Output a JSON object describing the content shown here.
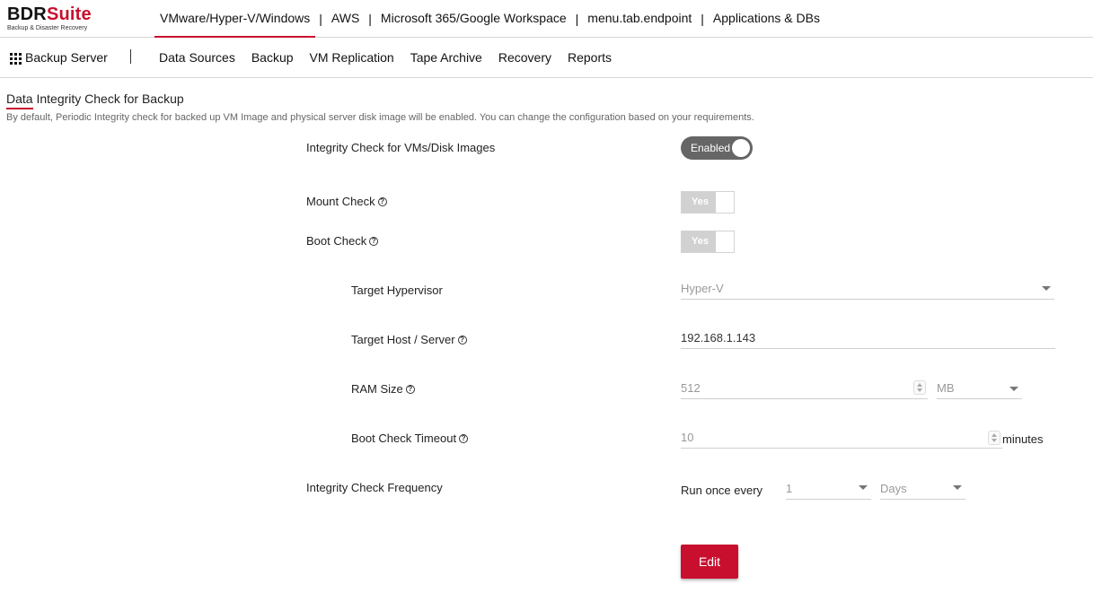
{
  "logo": {
    "brand_main": "BDR",
    "brand_accent": "Suite",
    "tagline": "Backup & Disaster Recovery"
  },
  "topnav": [
    {
      "label": "VMware/Hyper-V/Windows",
      "active": true
    },
    {
      "label": "AWS"
    },
    {
      "label": "Microsoft 365/Google Workspace"
    },
    {
      "label": "menu.tab.endpoint"
    },
    {
      "label": "Applications & DBs"
    }
  ],
  "topnav_separator": "|",
  "subbar": {
    "server_label": "Backup Server",
    "items": [
      "Data Sources",
      "Backup",
      "VM Replication",
      "Tape Archive",
      "Recovery",
      "Reports"
    ]
  },
  "page": {
    "title": "Data Integrity Check for Backup",
    "description": "By default, Periodic Integrity check for backed up VM Image and physical server disk image will be enabled. You can change the configuration based on your requirements."
  },
  "form": {
    "integrity_check": {
      "label": "Integrity Check for VMs/Disk Images",
      "toggle": "Enabled"
    },
    "mount_check": {
      "label": "Mount Check",
      "toggle": "Yes"
    },
    "boot_check": {
      "label": "Boot Check",
      "toggle": "Yes"
    },
    "target_hypervisor": {
      "label": "Target Hypervisor",
      "value": "Hyper-V"
    },
    "target_host": {
      "label": "Target Host / Server",
      "value": "192.168.1.143"
    },
    "ram_size": {
      "label": "RAM Size",
      "value": "512",
      "unit": "MB"
    },
    "boot_timeout": {
      "label": "Boot Check Timeout",
      "value": "10",
      "unit": "minutes"
    },
    "frequency": {
      "label": "Integrity Check Frequency",
      "prefix": "Run once every",
      "count": "1",
      "period": "Days"
    }
  },
  "edit_button": "Edit",
  "help_glyph": "?",
  "colors": {
    "accent": "#c8102e",
    "toggle_on": "#666666",
    "toggle_yes": "#d1d1d1"
  }
}
